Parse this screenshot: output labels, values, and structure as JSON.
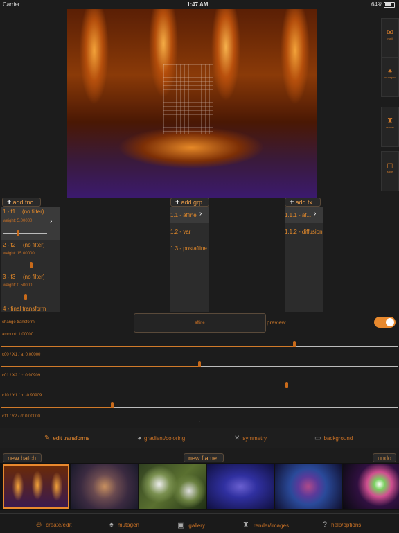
{
  "status": {
    "carrier": "Carrier",
    "time": "1:47 AM",
    "battery": "64%"
  },
  "side_tools": [
    {
      "icon": "✉",
      "label": "mail"
    },
    {
      "icon": "♠",
      "label": "mutagen"
    },
    {
      "icon": "♜",
      "label": "render"
    },
    {
      "icon": "◻",
      "label": "save"
    }
  ],
  "functions": {
    "add_label": "add fnc",
    "items": [
      {
        "name": "1 - f1",
        "filter": "(no filter)",
        "weight": "weight: 5.00000",
        "level": 0.35
      },
      {
        "name": "2 - f2",
        "filter": "(no filter)",
        "weight": "weight: 15.00000",
        "level": 0.5
      },
      {
        "name": "3 - f3",
        "filter": "(no filter)",
        "weight": "weight: 0.50000",
        "level": 0.4
      },
      {
        "name": "4 - final transform"
      }
    ]
  },
  "groups": {
    "add_label": "add grp",
    "items": [
      "1.1 - affine",
      "1.2 - var",
      "1.3 - postaffine"
    ]
  },
  "transforms": {
    "add_label": "add tx",
    "items": [
      "1.1.1 - af...",
      "1.1.2 - diffusion"
    ]
  },
  "change_transform_label": "change transform:",
  "transform_dropdown_value": "affine",
  "preview_label": "preview",
  "params": [
    {
      "label": "amount: 1.00000",
      "level": 0.74
    },
    {
      "label": "c00 / X1 / a: 0.00000",
      "level": 0.5
    },
    {
      "label": "c01 / X2 / c: 0.90909",
      "level": 0.72
    },
    {
      "label": "c10 / Y1 / b: -0.90909",
      "level": 0.28
    },
    {
      "label": "c11 / Y2 / d: 0.00000",
      "level": 0.5
    }
  ],
  "tabs": [
    "edit transforms",
    "gradient/coloring",
    "symmetry",
    "background"
  ],
  "batch": {
    "new_batch": "new batch",
    "new_flame": "new flame",
    "undo": "undo"
  },
  "nav": [
    "create/edit",
    "mutagen",
    "gallery",
    "render/images",
    "help/options"
  ],
  "colors": {
    "accent": "#e8892e",
    "background": "#1c1c1c"
  }
}
